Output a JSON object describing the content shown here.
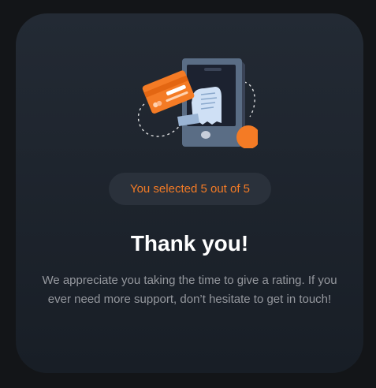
{
  "colors": {
    "background": "#131518",
    "card": "#1f252d",
    "accent": "#f47b25",
    "title": "#ffffff",
    "body_text": "#95989e",
    "badge_bg": "#2a313b"
  },
  "illustration": {
    "icon": "payment-phone-receipt-illustration"
  },
  "rating": {
    "selected": 5,
    "max": 5,
    "badge_text": "You selected 5 out of 5"
  },
  "thank_you": {
    "title": "Thank you!",
    "message": "We appreciate you taking the time to give a rating. If you ever need more support, don’t hesitate to get in touch!"
  }
}
